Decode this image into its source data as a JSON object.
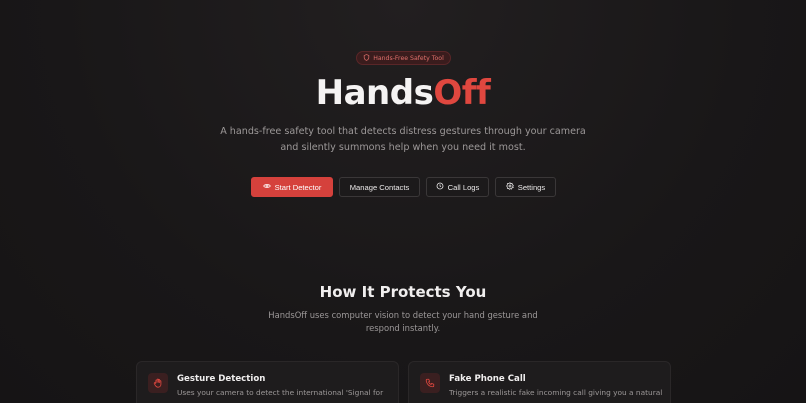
{
  "badge": {
    "label": "Hands-Free Safety Tool",
    "icon": "shield-icon"
  },
  "hero": {
    "title_main": "Hands",
    "title_accent": "Off",
    "subtitle": "A hands-free safety tool that detects distress gestures through your camera and silently summons help when you need it most."
  },
  "actions": {
    "start_detector": "Start Detector",
    "manage_contacts": "Manage Contacts",
    "call_logs": "Call Logs",
    "settings": "Settings"
  },
  "section": {
    "title": "How It Protects You",
    "subtitle": "HandsOff uses computer vision to detect your hand gesture and respond instantly."
  },
  "features": [
    {
      "title": "Gesture Detection",
      "description": "Uses your camera to detect the international 'Signal for",
      "icon": "hand-icon"
    },
    {
      "title": "Fake Phone Call",
      "description": "Triggers a realistic fake incoming call giving you a natural",
      "icon": "phone-icon"
    }
  ],
  "colors": {
    "accent": "#e0473f",
    "button_primary": "#d5413c",
    "background": "#1a1819"
  }
}
